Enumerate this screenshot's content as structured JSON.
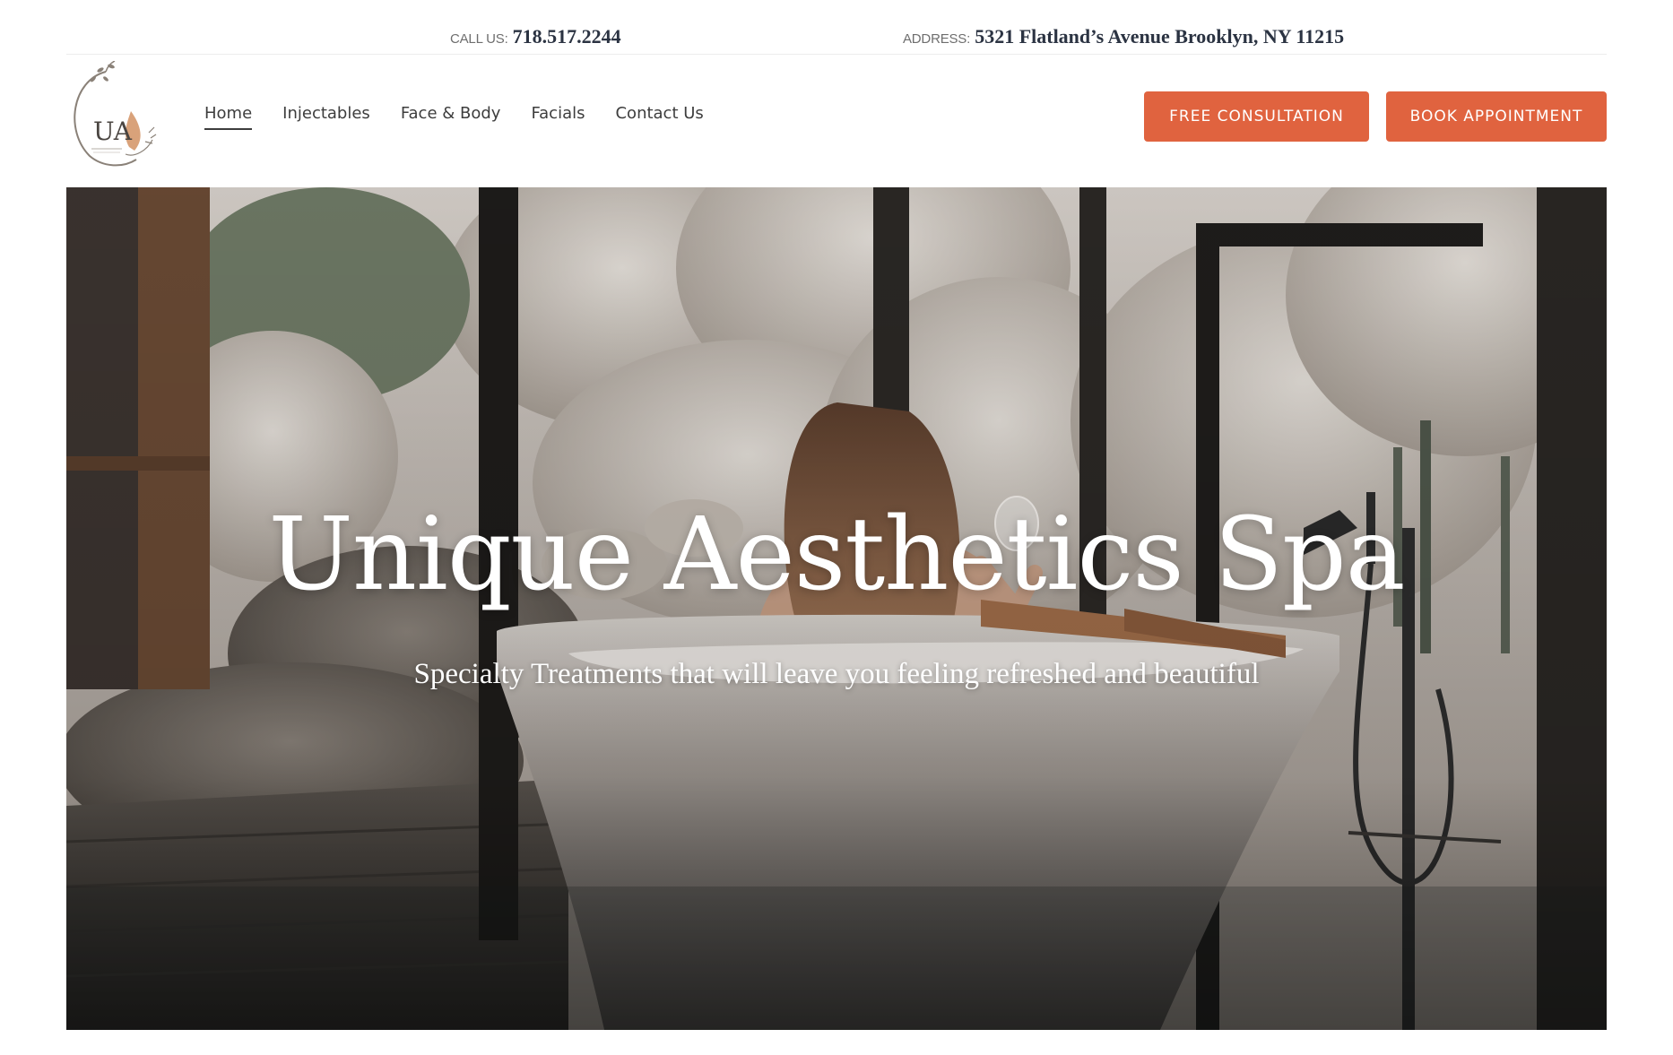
{
  "topbar": {
    "call_label": "CALL US:",
    "call_value": "718.517.2244",
    "address_label": "ADDRESS:",
    "address_value": "5321 Flatland’s Avenue Brooklyn, NY 11215"
  },
  "logo": {
    "text": "UA"
  },
  "nav": {
    "items": [
      {
        "label": "Home",
        "active": true
      },
      {
        "label": "Injectables"
      },
      {
        "label": "Face & Body"
      },
      {
        "label": "Facials"
      },
      {
        "label": "Contact Us"
      }
    ]
  },
  "buttons": {
    "consultation": "FREE CONSULTATION",
    "book": "BOOK APPOINTMENT"
  },
  "hero": {
    "title": "Unique Aesthetics Spa",
    "subtitle": "Specialty Treatments that will leave you feeling refreshed and beautiful"
  },
  "colors": {
    "accent": "#e0633f",
    "heading_dark": "#2b3342"
  }
}
